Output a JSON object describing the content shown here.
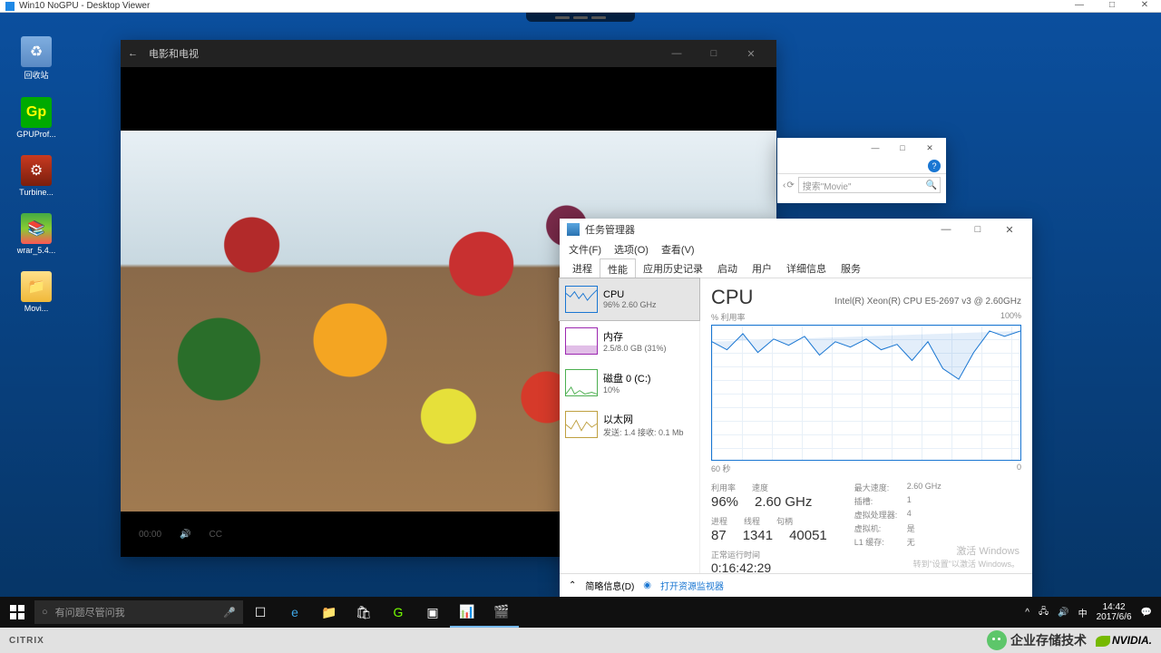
{
  "outer": {
    "title": "Win10 NoGPU - Desktop Viewer"
  },
  "desktop_icons": {
    "recycle": "回收站",
    "gpu": "GPUProf...",
    "turbine": "Turbine...",
    "winrar": "wrar_5.4...",
    "movie": "Movi..."
  },
  "movies_win": {
    "title": "电影和电视",
    "time": "00:00"
  },
  "explorer": {
    "search_placeholder": "搜索\"Movie\""
  },
  "taskmgr": {
    "title": "任务管理器",
    "menu": {
      "file": "文件(F)",
      "options": "选项(O)",
      "view": "查看(V)"
    },
    "tabs": {
      "processes": "进程",
      "performance": "性能",
      "history": "应用历史记录",
      "startup": "启动",
      "users": "用户",
      "details": "详细信息",
      "services": "服务"
    },
    "cards": {
      "cpu": {
        "h": "CPU",
        "s": "96% 2.60 GHz"
      },
      "mem": {
        "h": "内存",
        "s": "2.5/8.0 GB (31%)"
      },
      "disk": {
        "h": "磁盘 0 (C:)",
        "s": "10%"
      },
      "eth": {
        "h": "以太网",
        "s": "发送: 1.4 接收: 0.1 Mb"
      }
    },
    "panel": {
      "big": "CPU",
      "model": "Intel(R) Xeon(R) CPU E5-2697 v3 @ 2.60GHz",
      "ylab": "% 利用率",
      "ymax": "100%",
      "xl0": "60 秒",
      "xl1": "0",
      "row1_lbls": {
        "a": "利用率",
        "b": "速度"
      },
      "row1_vals": {
        "a": "96%",
        "b": "2.60 GHz"
      },
      "row2_lbls": {
        "a": "进程",
        "b": "线程",
        "c": "句柄"
      },
      "row2_vals": {
        "a": "87",
        "b": "1341",
        "c": "40051"
      },
      "meta": {
        "maxspeed_k": "最大速度:",
        "maxspeed_v": "2.60 GHz",
        "sockets_k": "插槽:",
        "sockets_v": "1",
        "vproc_k": "虚拟处理器:",
        "vproc_v": "4",
        "vm_k": "虚拟机:",
        "vm_v": "是",
        "l1_k": "L1 缓存:",
        "l1_v": "无"
      },
      "uptime_l": "正常运行时间",
      "uptime_v": "0:16:42:29"
    },
    "footer": {
      "fewer": "简略信息(D)",
      "resmon": "打开资源监视器"
    },
    "watermark": {
      "l1": "激活 Windows",
      "l2": "转到\"设置\"以激活 Windows。"
    }
  },
  "taskbar": {
    "search_placeholder": "有问题尽管问我",
    "clock": {
      "time": "14:42",
      "date": "2017/6/6"
    },
    "ime": "中"
  },
  "bottom": {
    "citrix": "CITRIX",
    "wechat": "企业存储技术",
    "nvidia": "NVIDIA."
  },
  "chart_data": {
    "type": "line",
    "title": "CPU % Utilization",
    "ylabel": "% 利用率",
    "ylim": [
      0,
      100
    ],
    "xlabel": "seconds",
    "xrange": [
      60,
      0
    ],
    "x": [
      60,
      57,
      54,
      51,
      48,
      45,
      42,
      39,
      36,
      33,
      30,
      27,
      24,
      21,
      18,
      15,
      12,
      9,
      6,
      3,
      0
    ],
    "values": [
      88,
      82,
      94,
      80,
      90,
      85,
      92,
      78,
      88,
      84,
      90,
      82,
      86,
      74,
      88,
      68,
      60,
      80,
      96,
      92,
      96
    ]
  }
}
